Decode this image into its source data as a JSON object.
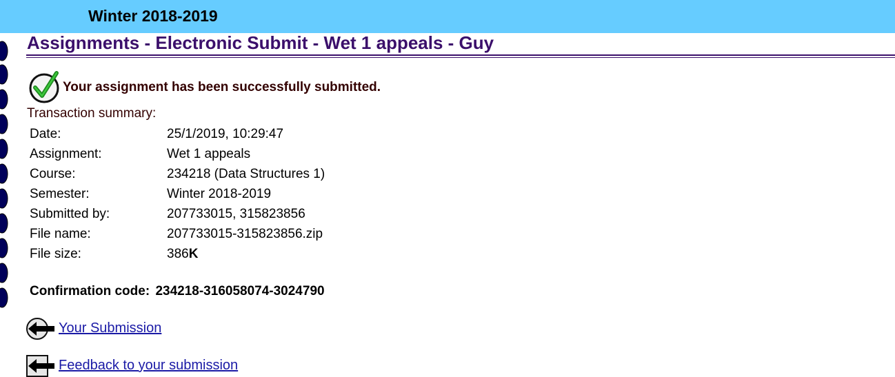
{
  "header": {
    "semester": "Winter 2018-2019"
  },
  "page_title": "Assignments - Electronic Submit - Wet 1 appeals - Guy",
  "success_message": "Your assignment has been successfully submitted.",
  "summary_label": "Transaction summary:",
  "summary": [
    {
      "key": "Date:",
      "value": "25/1/2019, 10:29:47"
    },
    {
      "key": "Assignment:",
      "value": "Wet 1 appeals"
    },
    {
      "key": "Course:",
      "value": "234218 (Data Structures 1)"
    },
    {
      "key": "Semester:",
      "value": "Winter 2018-2019"
    },
    {
      "key": "Submitted by:",
      "value": "207733015, 315823856"
    },
    {
      "key": "File name:",
      "value": "207733015-315823856.zip"
    },
    {
      "key": "File size:",
      "value": "386",
      "unit": "K"
    }
  ],
  "confirmation": {
    "label": "Confirmation code:",
    "code": "234218-316058074-3024790"
  },
  "links": [
    {
      "label": " Your Submission",
      "icon": "back-arrow-icon"
    },
    {
      "label": " Feedback to your submission",
      "icon": "back-arrow-icon"
    }
  ],
  "colors": {
    "header_bg": "#66ccff",
    "title": "#3b0f6b",
    "link": "#1a1aa6",
    "binding": "#00005a"
  }
}
